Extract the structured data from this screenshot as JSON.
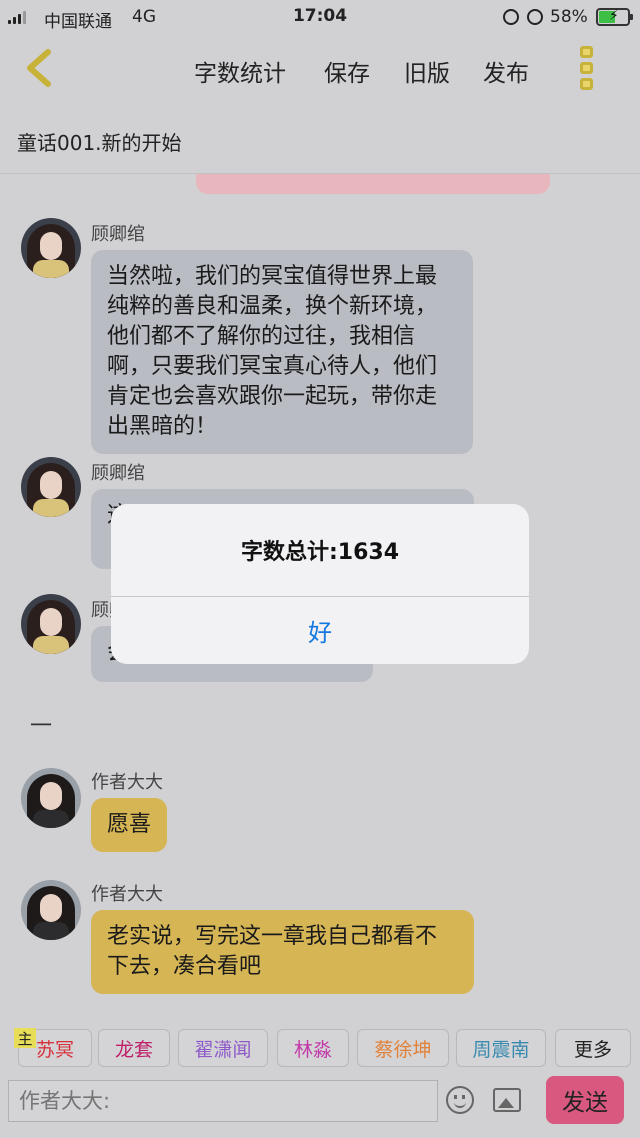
{
  "status_bar": {
    "carrier": "中国联通",
    "network": "4G",
    "time": "17:04",
    "battery_percent": "58%"
  },
  "nav": {
    "word_count": "字数统计",
    "save": "保存",
    "old_version": "旧版",
    "publish": "发布"
  },
  "chapter_title": "童话001.新的开始",
  "messages": [
    {
      "name": "顾卿绾",
      "text": "当然啦，我们的冥宝值得世界上最纯粹的善良和温柔，换个新环境，他们都不了解你的过往，我相信啊，只要我们冥宝真心待人，他们肯定也会喜欢跟你一起玩，带你走出黑暗的！"
    },
    {
      "name": "顾卿绾",
      "text": "这"
    },
    {
      "name": "顾卿绾",
      "text": "会"
    },
    {
      "divider": "一"
    },
    {
      "name": "作者大大",
      "text": "愿喜"
    },
    {
      "name": "作者大大",
      "text": "老实说，写完这一章我自己都看不下去，凑合看吧"
    }
  ],
  "character_tags": {
    "badge": "主",
    "items": [
      {
        "label": "苏冥",
        "color": "#d6303a"
      },
      {
        "label": "龙套",
        "color": "#c0206a"
      },
      {
        "label": "翟潇闻",
        "color": "#8e5ac8"
      },
      {
        "label": "林淼",
        "color": "#c23aa8"
      },
      {
        "label": "蔡徐坤",
        "color": "#e0823a"
      },
      {
        "label": "周震南",
        "color": "#3a8ab0"
      },
      {
        "label": "更多",
        "color": "#222222"
      }
    ]
  },
  "input": {
    "placeholder": "作者大大:",
    "send_label": "发送"
  },
  "alert": {
    "message": "字数总计:1634",
    "ok_label": "好"
  }
}
